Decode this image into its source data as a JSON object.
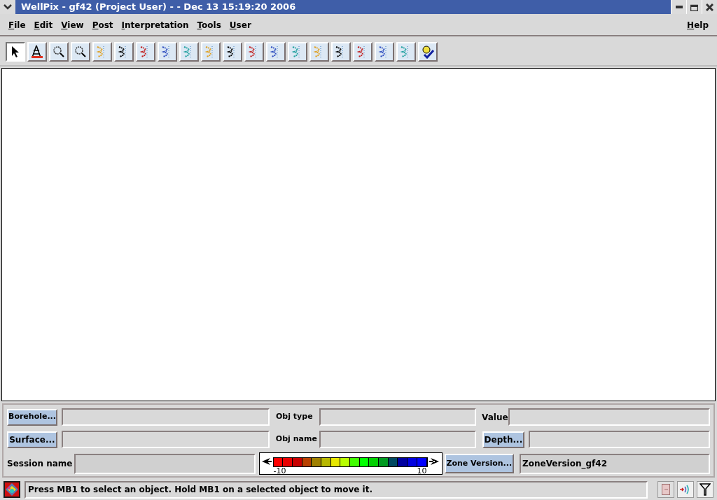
{
  "window": {
    "title": "WellPix - gf42  (Project User) - - Dec 13 15:19:20 2006"
  },
  "menu": [
    "File",
    "Edit",
    "View",
    "Post",
    "Interpretation",
    "Tools",
    "User"
  ],
  "help_menu": "Help",
  "toolbar": [
    {
      "selected": true
    },
    {
      "selected": false
    },
    {
      "selected": false
    },
    {
      "selected": false
    },
    {
      "selected": false
    },
    {
      "selected": false
    },
    {
      "selected": false
    },
    {
      "selected": false
    },
    {
      "selected": false
    },
    {
      "selected": false
    },
    {
      "selected": false
    },
    {
      "selected": false
    },
    {
      "selected": false
    },
    {
      "selected": false
    },
    {
      "selected": false
    },
    {
      "selected": false
    },
    {
      "selected": false
    },
    {
      "selected": false
    },
    {
      "selected": false
    },
    {
      "selected": false
    }
  ],
  "info": {
    "borehole_button": "Borehole...",
    "surface_button": "Surface...",
    "session_label": "Session name",
    "obj_type_label": "Obj type",
    "obj_name_label": "Obj name",
    "value_label": "Value",
    "depth_button": "Depth...",
    "zone_button": "Zone Version...",
    "zone_value": "ZoneVersion_gf42"
  },
  "color_scale": {
    "min_label": "-10",
    "max_label": "10",
    "swatches": [
      {
        "color": "#ff0000"
      },
      {
        "color": "#e80000"
      },
      {
        "color": "#c80000"
      },
      {
        "color": "#b84000"
      },
      {
        "color": "#a08000"
      },
      {
        "color": "#b8b800"
      },
      {
        "color": "#e8e800"
      },
      {
        "color": "#b8ff00"
      },
      {
        "color": "#40ff00"
      },
      {
        "color": "#00ff00"
      },
      {
        "color": "#00d000"
      },
      {
        "color": "#009a20"
      },
      {
        "color": "#004860"
      },
      {
        "color": "#0000a0"
      },
      {
        "color": "#0000e0"
      },
      {
        "color": "#0000ff"
      }
    ]
  },
  "status_bar": {
    "message": "Press MB1 to select an object. Hold MB1 on a selected object to move it."
  }
}
